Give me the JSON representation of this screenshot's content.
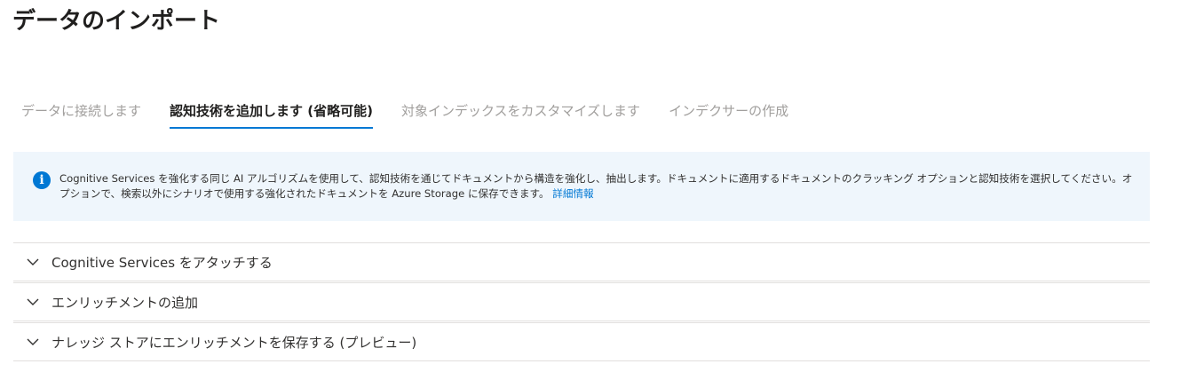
{
  "page": {
    "title": "データのインポート"
  },
  "tabs": [
    {
      "label": "データに接続します",
      "active": false
    },
    {
      "label": "認知技術を追加します (省略可能)",
      "active": true
    },
    {
      "label": "対象インデックスをカスタマイズします",
      "active": false
    },
    {
      "label": "インデクサーの作成",
      "active": false
    }
  ],
  "info": {
    "icon": "info-icon",
    "text": "Cognitive Services を強化する同じ AI アルゴリズムを使用して、認知技術を通じてドキュメントから構造を強化し、抽出します。ドキュメントに適用するドキュメントのクラッキング オプションと認知技術を選択してください。オプションで、検索以外にシナリオで使用する強化されたドキュメントを Azure Storage に保存できます。",
    "link": "詳細情報"
  },
  "sections": [
    {
      "label": "Cognitive Services をアタッチする",
      "icon": "chevron-down-icon"
    },
    {
      "label": "エンリッチメントの追加",
      "icon": "chevron-down-icon"
    },
    {
      "label": "ナレッジ ストアにエンリッチメントを保存する (プレビュー)",
      "icon": "chevron-down-icon"
    }
  ],
  "colors": {
    "accent": "#0078d4",
    "info_background": "#eff6fc",
    "inactive_tab": "#a19f9d",
    "divider": "#e1dfdd"
  }
}
